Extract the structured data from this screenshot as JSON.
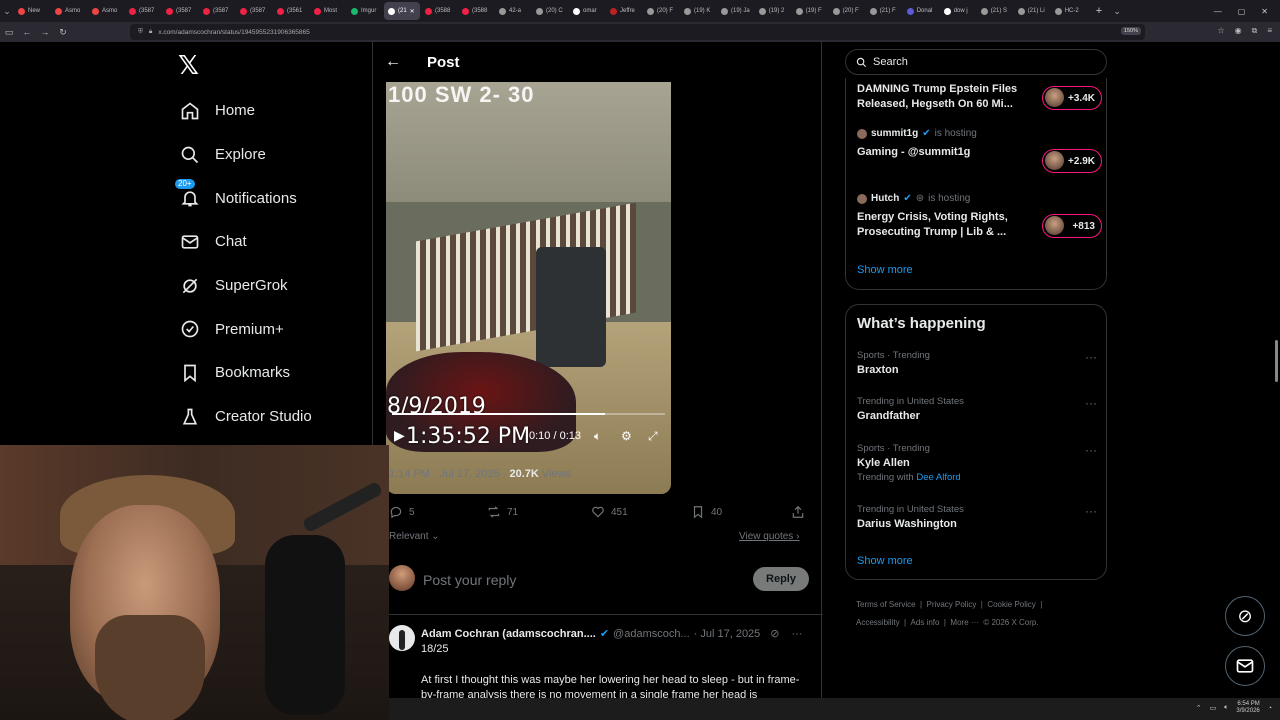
{
  "browser": {
    "tabs": [
      {
        "label": "New",
        "color": "#e44"
      },
      {
        "label": "Asmo",
        "color": "#e44"
      },
      {
        "label": "Asmo",
        "color": "#e44"
      },
      {
        "label": "(3587",
        "color": "#e24"
      },
      {
        "label": "(3587",
        "color": "#e24"
      },
      {
        "label": "(3587",
        "color": "#e24"
      },
      {
        "label": "(3587",
        "color": "#e24"
      },
      {
        "label": "(3561",
        "color": "#e24"
      },
      {
        "label": "Most",
        "color": "#e24"
      },
      {
        "label": "Imgur",
        "color": "#1bb76e"
      },
      {
        "label": "(21",
        "color": "#fff",
        "active": true
      },
      {
        "label": "(3588",
        "color": "#e24"
      },
      {
        "label": "(3588",
        "color": "#e24"
      },
      {
        "label": "42-a",
        "color": "#999"
      },
      {
        "label": "(20) C",
        "color": "#999"
      },
      {
        "label": "omar",
        "color": "#fff"
      },
      {
        "label": "Jeffre",
        "color": "#b22"
      },
      {
        "label": "(20) F",
        "color": "#999"
      },
      {
        "label": "(19) K",
        "color": "#999"
      },
      {
        "label": "(19) Ja",
        "color": "#999"
      },
      {
        "label": "(19) 2",
        "color": "#999"
      },
      {
        "label": "(19) F",
        "color": "#999"
      },
      {
        "label": "(20) F",
        "color": "#999"
      },
      {
        "label": "(21) F",
        "color": "#999"
      },
      {
        "label": "Donal",
        "color": "#5b5bd6"
      },
      {
        "label": "dow j",
        "color": "#fff"
      },
      {
        "label": "(21) S",
        "color": "#999"
      },
      {
        "label": "(21) Li",
        "color": "#999"
      },
      {
        "label": "HC-2",
        "color": "#999"
      }
    ],
    "url": "x.com/adamscochran/status/1945955231906365865",
    "zoom": "150%"
  },
  "sidebar": {
    "items": [
      {
        "label": "Home",
        "icon": "home-icon"
      },
      {
        "label": "Explore",
        "icon": "search-icon"
      },
      {
        "label": "Notifications",
        "icon": "bell-icon",
        "badge": "20+"
      },
      {
        "label": "Chat",
        "icon": "mail-icon"
      },
      {
        "label": "SuperGrok",
        "icon": "grok-icon"
      },
      {
        "label": "Premium+",
        "icon": "verified-icon"
      },
      {
        "label": "Bookmarks",
        "icon": "bookmark-icon"
      },
      {
        "label": "Creator Studio",
        "icon": "flask-icon"
      }
    ]
  },
  "post": {
    "header_title": "Post",
    "video": {
      "top_text": "100 SW 2- 30",
      "date": "8/9/2019",
      "time": "1:35:52 PM",
      "timecode": "0:10 / 0:13",
      "progress": 0.78
    },
    "meta_time": "1:14 PM · Jul 17, 2025 · ",
    "views_count": "20.7K",
    "views_label": " Views",
    "actions": {
      "replies": "5",
      "reposts": "71",
      "likes": "451",
      "bookmarks": "40"
    },
    "relevant_label": "Relevant",
    "view_quotes_label": "View quotes",
    "reply_placeholder": "Post your reply",
    "reply_button": "Reply"
  },
  "tweet": {
    "name": "Adam Cochran (adamscochran....",
    "handle": "@adamscoch...",
    "date": "· Jul 17, 2025",
    "number": "18/25",
    "text": "At first I thought this was maybe her lowering her head to sleep - but in frame-by-frame analysis there is no movement in a single frame her head is"
  },
  "right": {
    "search_placeholder": "Search",
    "spaces": [
      {
        "host": "",
        "hosting": "",
        "title": "DAMNING Trump Epstein Files Released, Hegseth On 60 Mi...",
        "count": "+3.4K"
      },
      {
        "host": "summit1g",
        "hosting": "is hosting",
        "title": "Gaming - @summit1g",
        "count": "+2.9K"
      },
      {
        "host": "Hutch",
        "hosting": "is hosting",
        "title": "Energy Crisis, Voting Rights, Prosecuting Trump | Lib & ...",
        "count": "+813"
      }
    ],
    "show_more": "Show more",
    "happening_title": "What’s happening",
    "trends": [
      {
        "context": "Sports · Trending",
        "title": "Braxton"
      },
      {
        "context": "Trending in United States",
        "title": "Grandfather"
      },
      {
        "context": "Sports · Trending",
        "title": "Kyle Allen",
        "with_label": "Trending with",
        "with_link": "Dee Alford"
      },
      {
        "context": "Trending in United States",
        "title": "Darius Washington"
      }
    ],
    "show_more_2": "Show more",
    "footer": {
      "terms": "Terms of Service",
      "privacy": "Privacy Policy",
      "cookie": "Cookie Policy",
      "accessibility": "Accessibility",
      "ads": "Ads info",
      "more": "More ···",
      "copyright": "© 2026 X Corp."
    }
  },
  "taskbar": {
    "time": "6:54 PM",
    "date": "3/9/2026"
  },
  "colors": {
    "accent": "#1d9bf0",
    "live_pill": "#f91880",
    "border": "#2f3336",
    "muted": "#71767b"
  }
}
